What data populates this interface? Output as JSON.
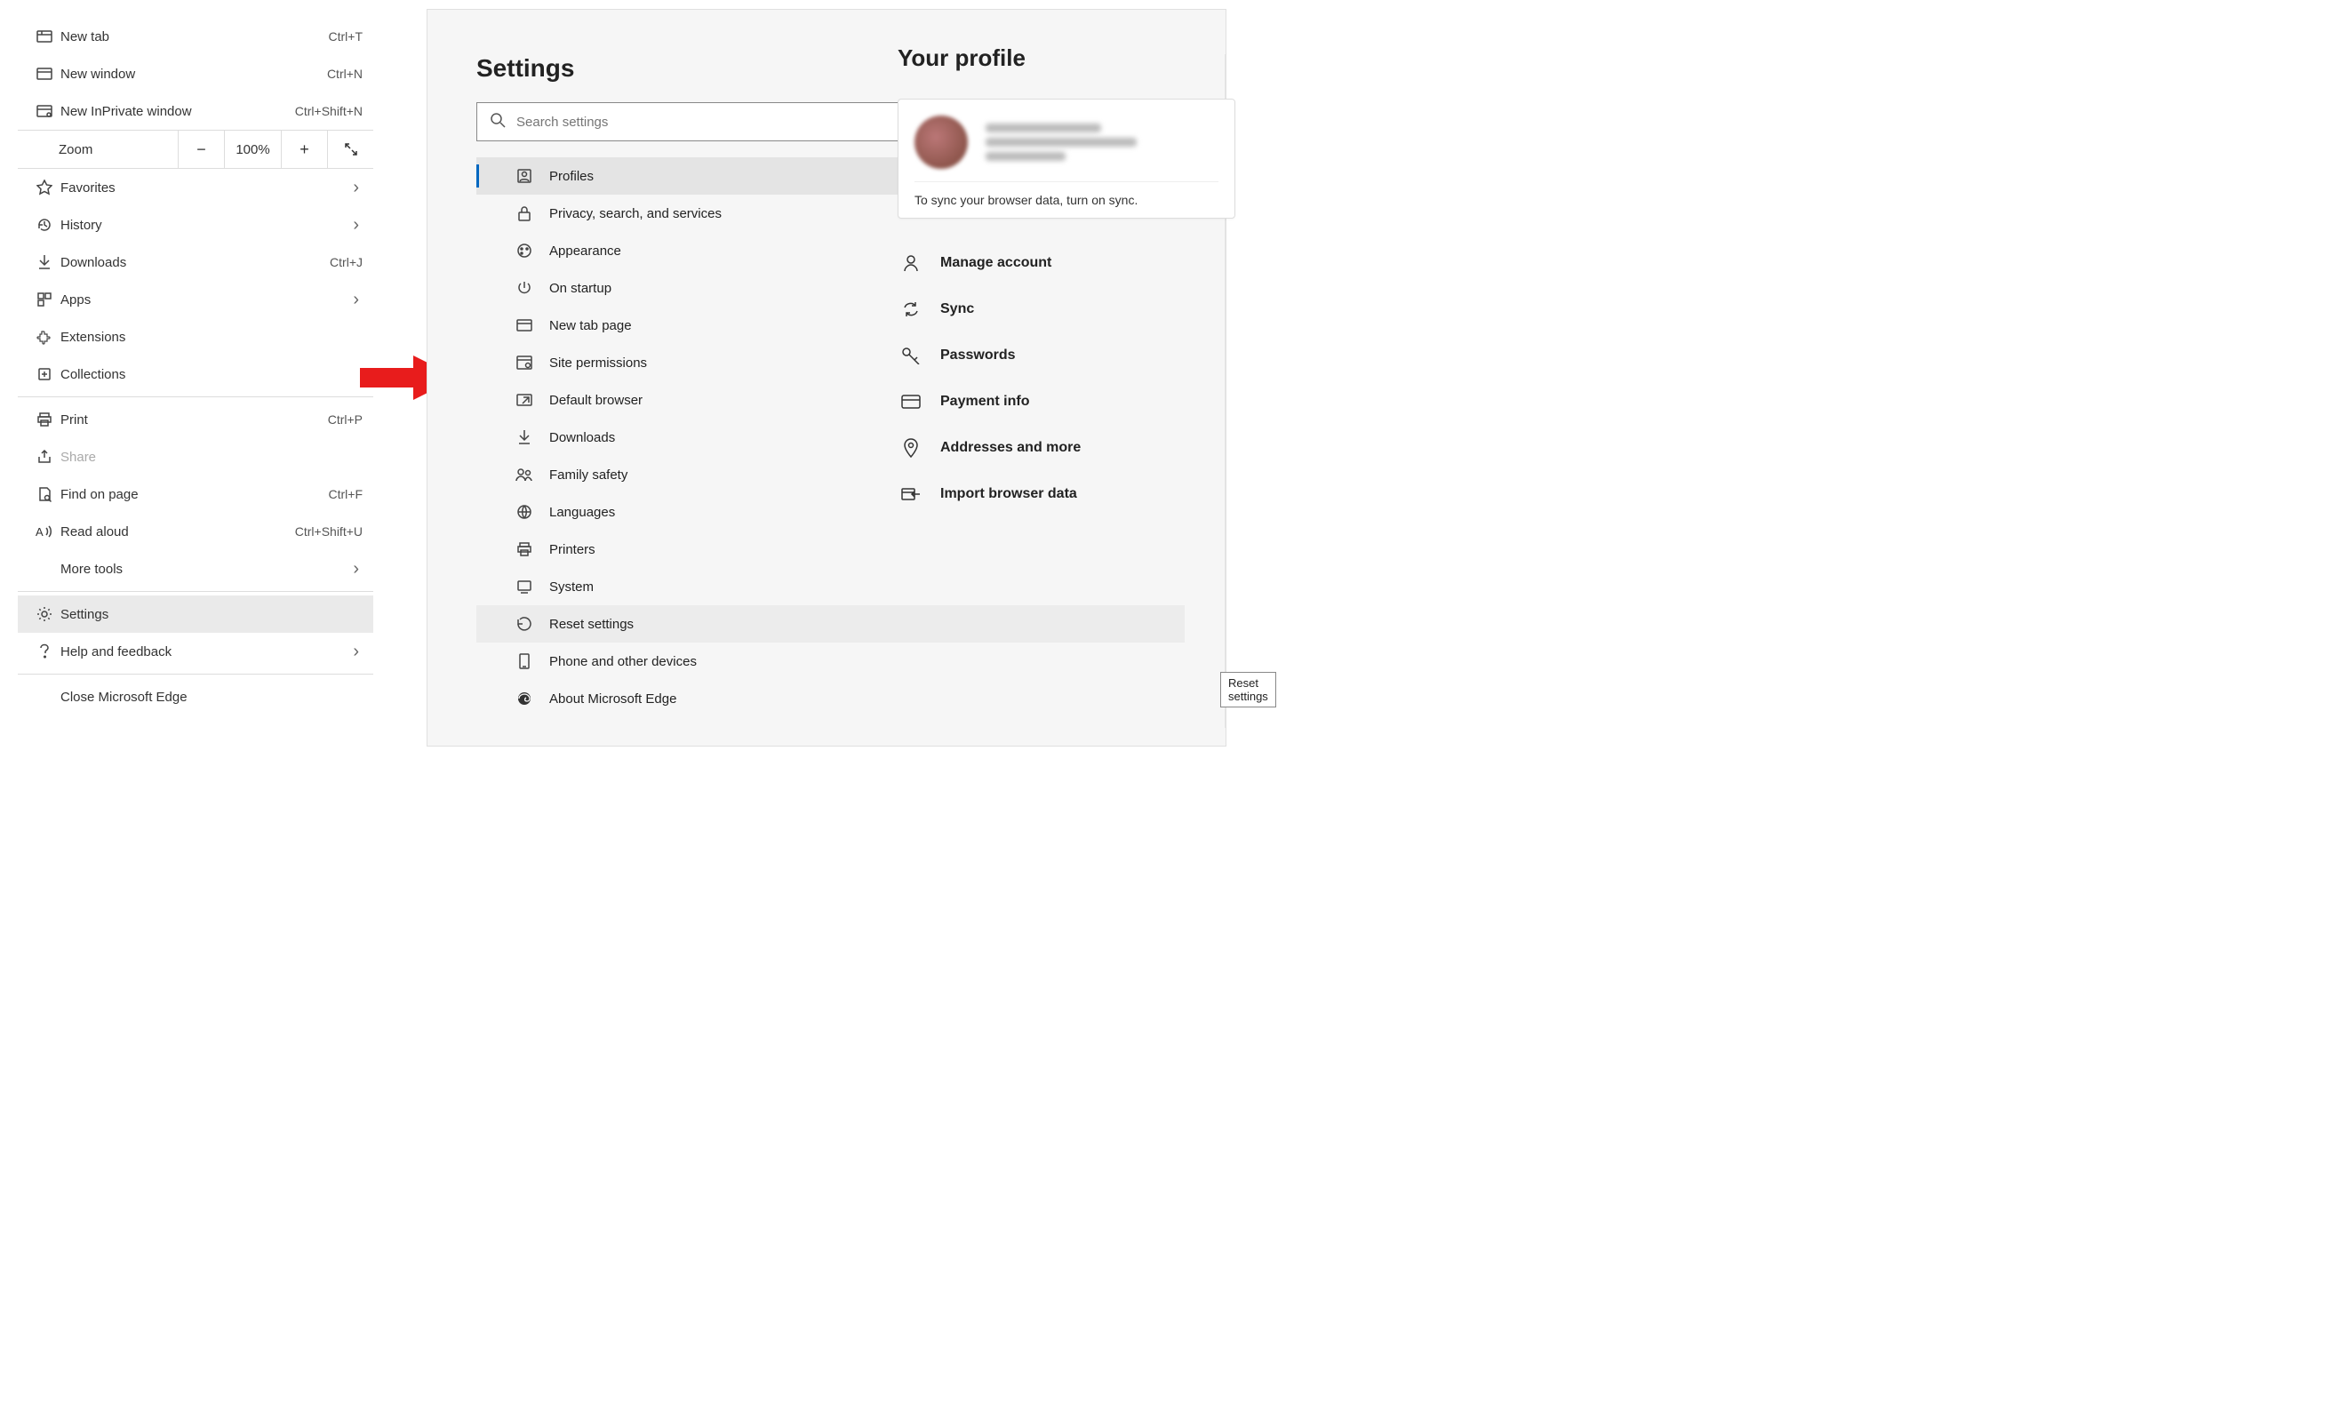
{
  "menu": {
    "new_tab": {
      "label": "New tab",
      "shortcut": "Ctrl+T"
    },
    "new_window": {
      "label": "New window",
      "shortcut": "Ctrl+N"
    },
    "inprivate": {
      "label": "New InPrivate window",
      "shortcut": "Ctrl+Shift+N"
    },
    "zoom": {
      "label": "Zoom",
      "value": "100%"
    },
    "favorites": {
      "label": "Favorites"
    },
    "history": {
      "label": "History"
    },
    "downloads": {
      "label": "Downloads",
      "shortcut": "Ctrl+J"
    },
    "apps": {
      "label": "Apps"
    },
    "extensions": {
      "label": "Extensions"
    },
    "collections": {
      "label": "Collections"
    },
    "print": {
      "label": "Print",
      "shortcut": "Ctrl+P"
    },
    "share": {
      "label": "Share"
    },
    "find": {
      "label": "Find on page",
      "shortcut": "Ctrl+F"
    },
    "read_aloud": {
      "label": "Read aloud",
      "shortcut": "Ctrl+Shift+U"
    },
    "more_tools": {
      "label": "More tools"
    },
    "settings": {
      "label": "Settings"
    },
    "help": {
      "label": "Help and feedback"
    },
    "close": {
      "label": "Close Microsoft Edge"
    }
  },
  "settings": {
    "title": "Settings",
    "search_placeholder": "Search settings",
    "nav": {
      "profiles": "Profiles",
      "privacy": "Privacy, search, and services",
      "appearance": "Appearance",
      "startup": "On startup",
      "newtab": "New tab page",
      "site_perm": "Site permissions",
      "default_browser": "Default browser",
      "downloads": "Downloads",
      "family": "Family safety",
      "languages": "Languages",
      "printers": "Printers",
      "system": "System",
      "reset": "Reset settings",
      "phone": "Phone and other devices",
      "about": "About Microsoft Edge"
    },
    "tooltip_reset": "Reset settings"
  },
  "profile": {
    "title": "Your profile",
    "sync_msg": "To sync your browser data, turn on sync.",
    "actions": {
      "manage": "Manage account",
      "sync": "Sync",
      "passwords": "Passwords",
      "payment": "Payment info",
      "addresses": "Addresses and more",
      "import": "Import browser data"
    }
  }
}
